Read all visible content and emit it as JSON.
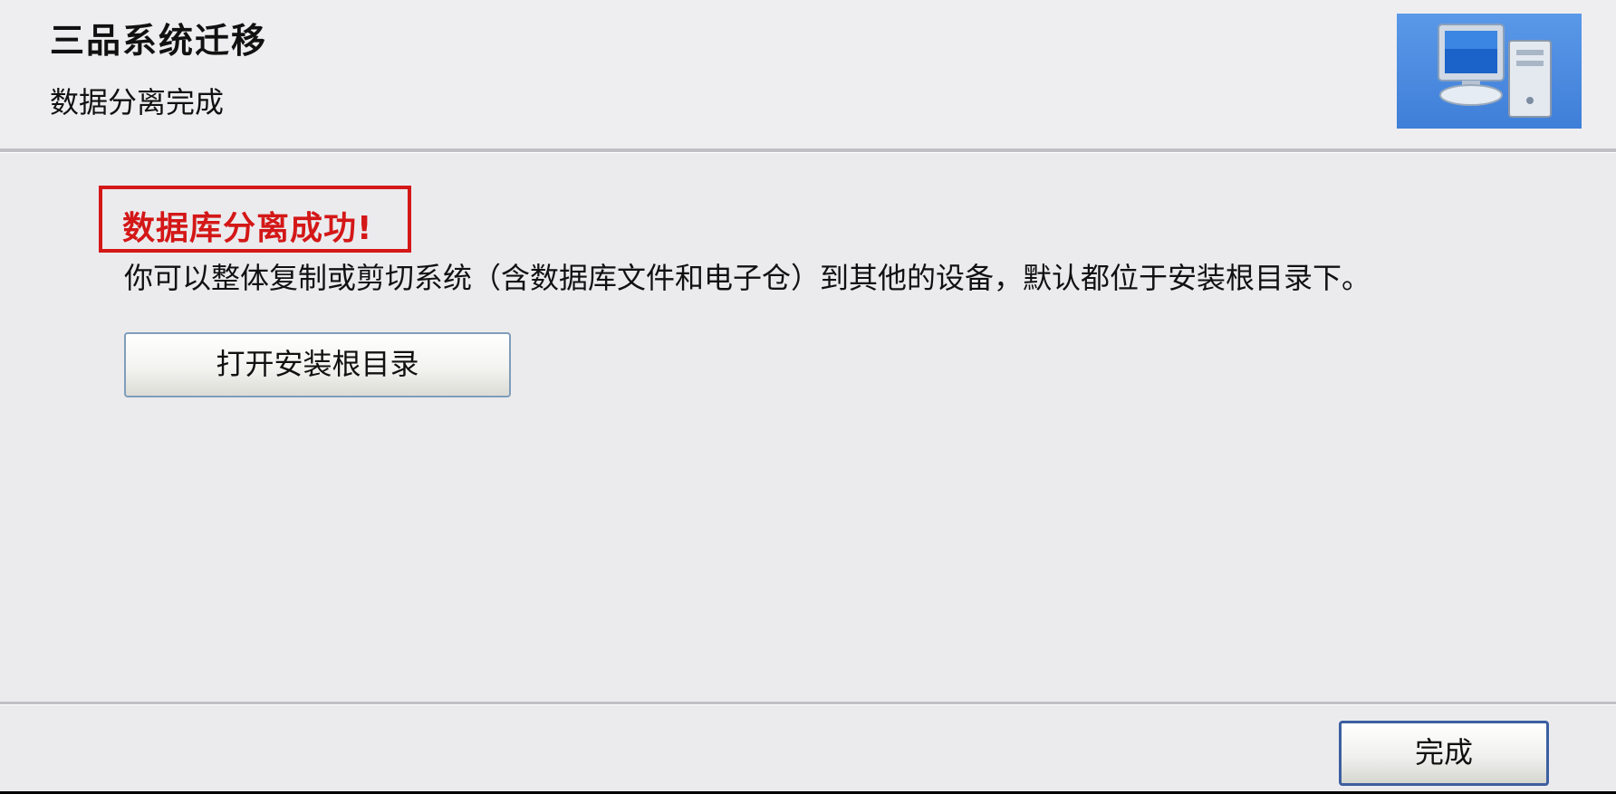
{
  "header": {
    "title": "三品系统迁移",
    "subtitle": "数据分离完成",
    "image_icon": "computer-icon"
  },
  "content": {
    "success_message": "数据库分离成功!",
    "description": "你可以整体复制或剪切系统（含数据库文件和电子仓）到其他的设备，默认都位于安装根目录下。",
    "open_dir_button": "打开安装根目录"
  },
  "footer": {
    "finish_button": "完成"
  },
  "colors": {
    "success": "#d41717",
    "header_image_bg": "#4a8ae0",
    "button_border": "#7f9db9",
    "default_button_border": "#3c5fa0"
  }
}
